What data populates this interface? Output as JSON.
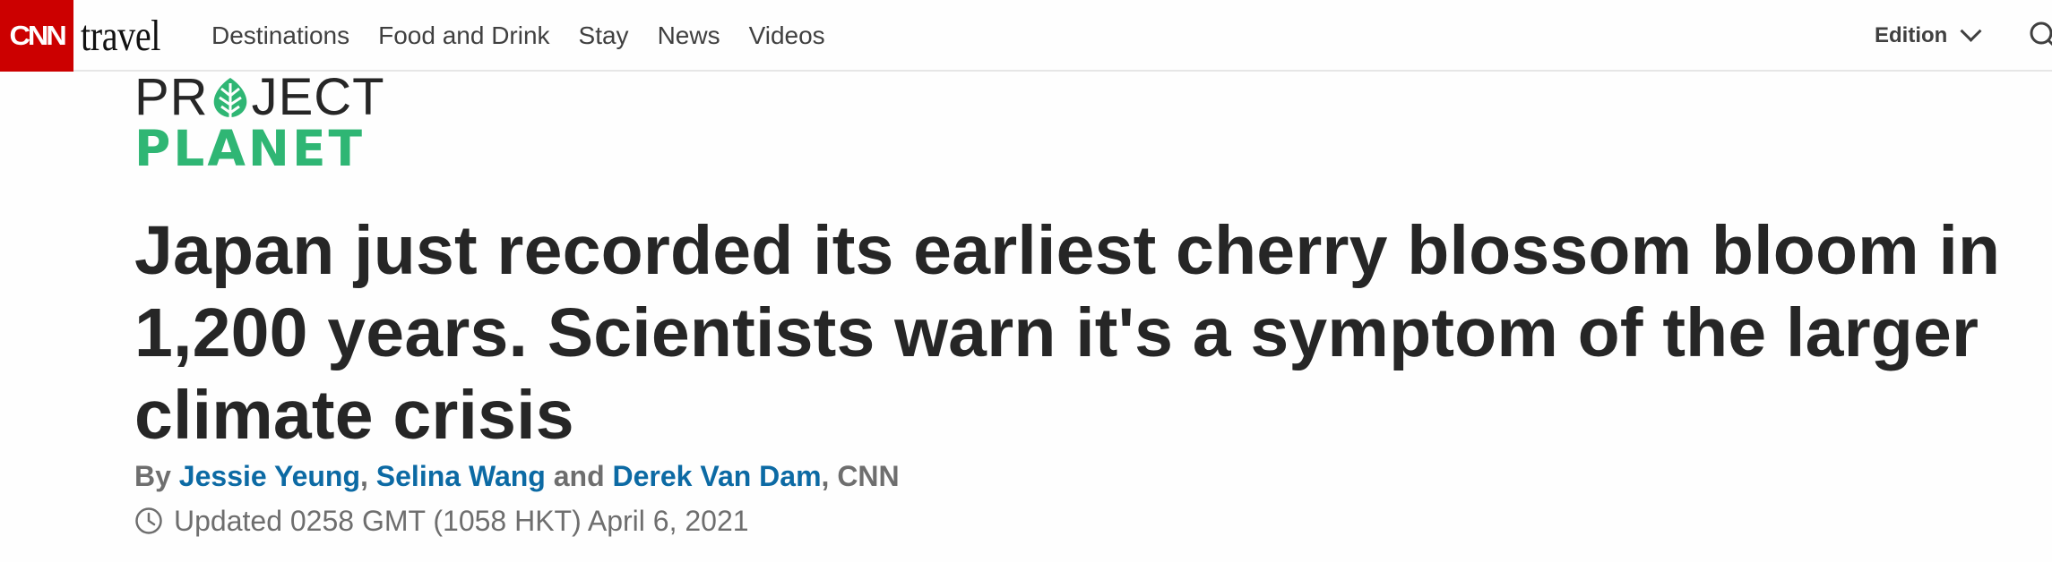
{
  "header": {
    "brand_logo_text": "CNN",
    "section_label": "travel",
    "nav_items": [
      {
        "label": "Destinations"
      },
      {
        "label": "Food and Drink"
      },
      {
        "label": "Stay"
      },
      {
        "label": "News"
      },
      {
        "label": "Videos"
      }
    ],
    "edition_label": "Edition",
    "icons": {
      "edition": "chevron-down-icon",
      "search": "search-icon"
    }
  },
  "project_planet": {
    "line1_left": "PR",
    "line1_right": "JECT",
    "line2": "PLANET",
    "accent_color": "#2fb674"
  },
  "article": {
    "headline": "Japan just recorded its earliest cherry blossom bloom in 1,200 years. Scientists warn it's a symptom of the larger climate crisis",
    "byline_prefix": "By",
    "authors": [
      "Jessie Yeung",
      "Selina Wang",
      "Derek Van Dam"
    ],
    "byline_sep1": ",",
    "byline_and": "and",
    "byline_sep2": ",",
    "byline_outlet": "CNN",
    "updated": "Updated 0258 GMT (1058 HKT) April 6, 2021",
    "author_link_color": "#0c6aa4"
  },
  "colors": {
    "brand_red": "#cc0000",
    "text": "#262626",
    "muted": "#6e6e6e"
  }
}
